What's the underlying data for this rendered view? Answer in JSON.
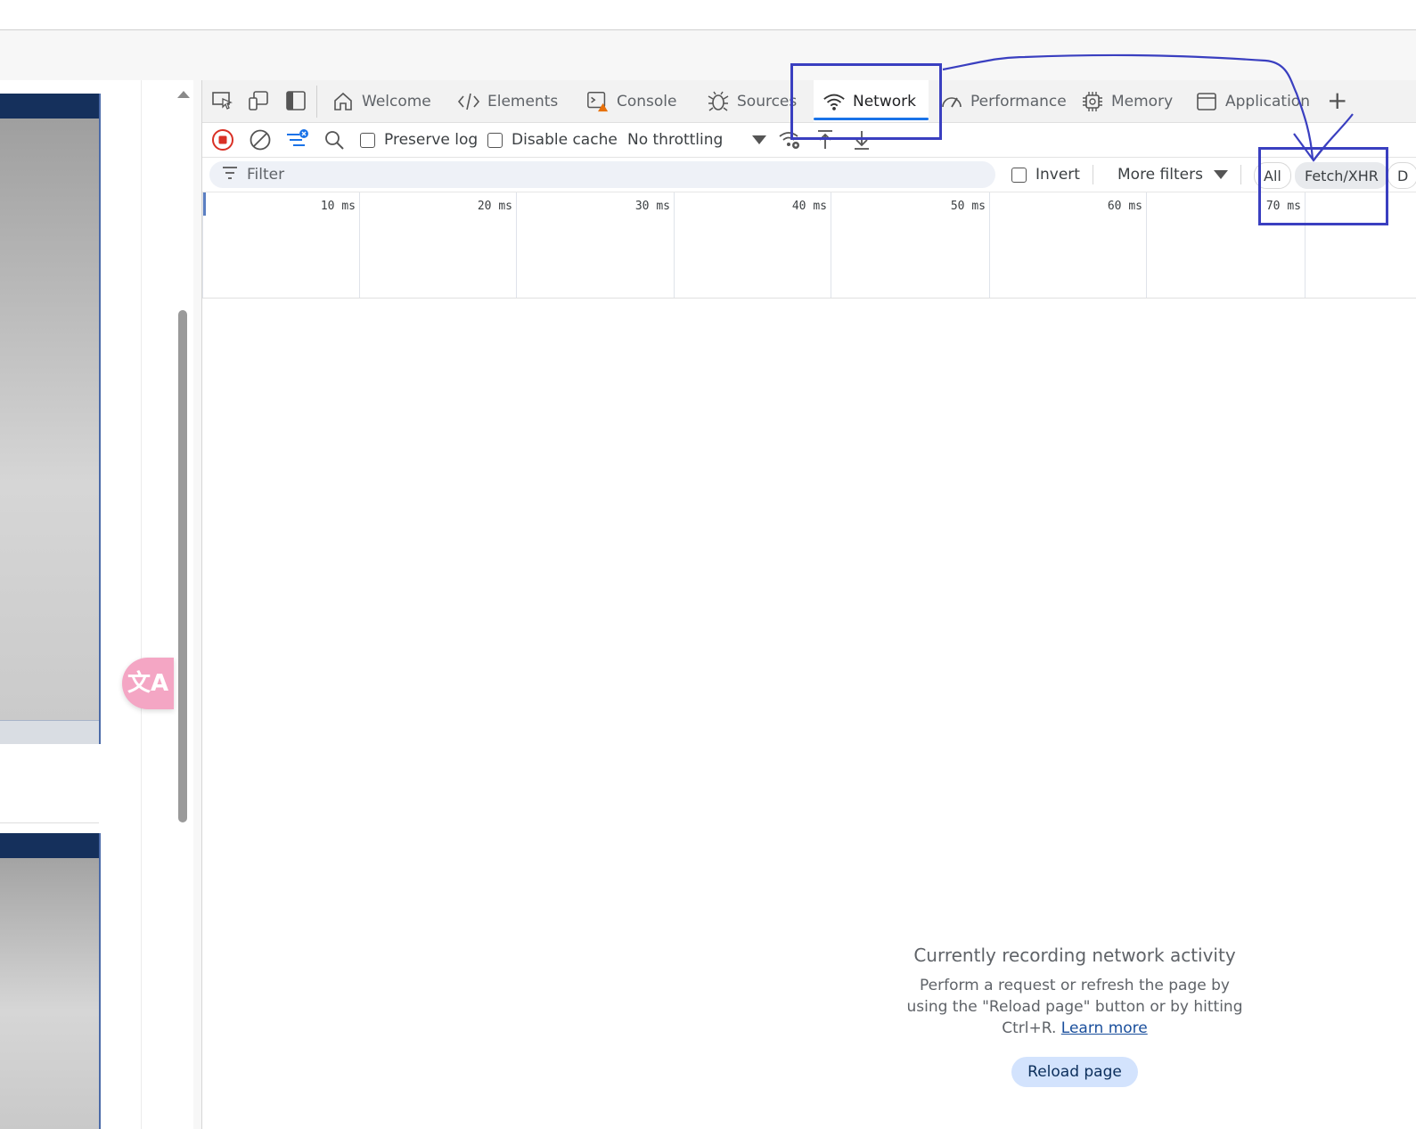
{
  "tabs": [
    {
      "label": "Welcome",
      "icon": "home-icon"
    },
    {
      "label": "Elements",
      "icon": "code-icon"
    },
    {
      "label": "Console",
      "icon": "console-icon"
    },
    {
      "label": "Sources",
      "icon": "bug-icon"
    },
    {
      "label": "Network",
      "icon": "wifi-icon",
      "active": true
    },
    {
      "label": "Performance",
      "icon": "gauge-icon"
    },
    {
      "label": "Memory",
      "icon": "chip-icon"
    },
    {
      "label": "Application",
      "icon": "window-icon"
    }
  ],
  "toolbar": {
    "preserve_log": "Preserve log",
    "disable_cache": "Disable cache",
    "throttling": "No throttling"
  },
  "filter": {
    "placeholder": "Filter",
    "invert": "Invert",
    "more_filters": "More filters",
    "chip_all": "All",
    "chip_fetch": "Fetch/XHR",
    "chip_doc": "D"
  },
  "timeline": {
    "ticks": [
      "10 ms",
      "20 ms",
      "30 ms",
      "40 ms",
      "50 ms",
      "60 ms",
      "70 ms"
    ]
  },
  "empty_state": {
    "title": "Currently recording network activity",
    "line1": "Perform a request or refresh the page by",
    "line2": "using the \"Reload page\" button or by hitting",
    "line3": "Ctrl+R.",
    "learn_more": "Learn more",
    "reload_button": "Reload page"
  },
  "colors": {
    "accent": "#1a73e8",
    "annotation": "#3a3fc0",
    "record": "#d93025"
  }
}
